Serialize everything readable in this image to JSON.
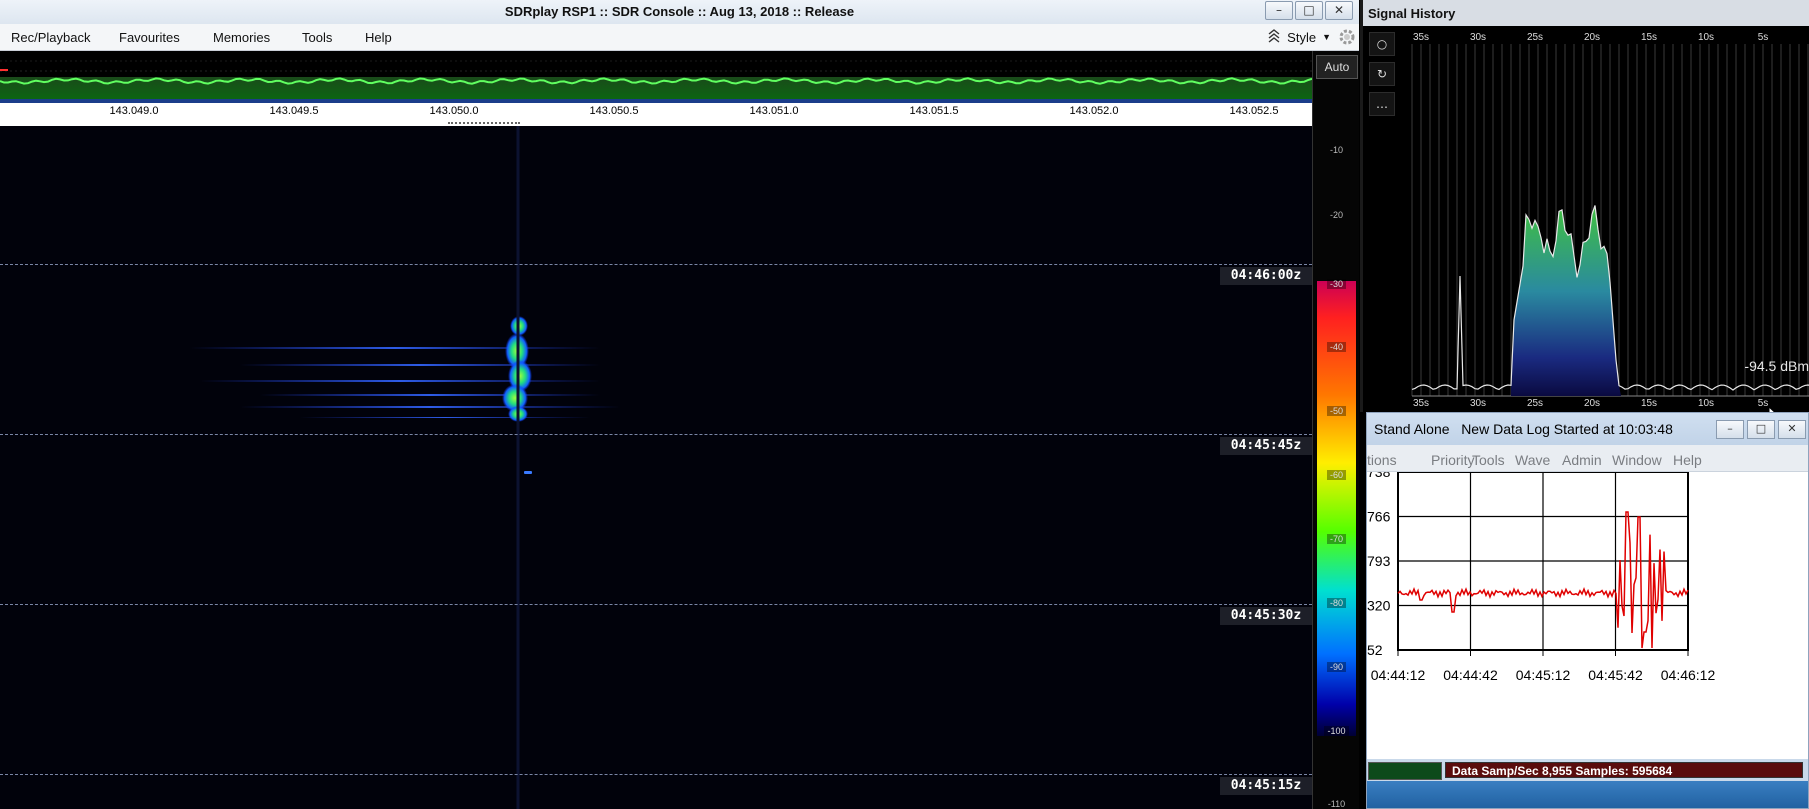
{
  "sdr": {
    "title": "SDRplay RSP1 :: SDR Console :: Aug 13, 2018 :: Release",
    "menu": [
      "Rec/Playback",
      "Favourites",
      "Memories",
      "Tools",
      "Help"
    ],
    "style_label": "Style",
    "freq_labels": [
      "143.049.0",
      "143.049.5",
      "143.050.0",
      "143.050.5",
      "143.051.0",
      "143.051.5",
      "143.052.0",
      "143.052.5"
    ],
    "time_labels": [
      "04:46:00z",
      "04:45:45z",
      "04:45:30z",
      "04:45:15z"
    ],
    "scale": {
      "auto_label": "Auto",
      "values": [
        "-10",
        "-20",
        "-30",
        "-40",
        "-50",
        "-60",
        "-70",
        "-80",
        "-90",
        "-100",
        "-110"
      ]
    },
    "colors": {
      "waterfall_bg": "#01020b",
      "spectrum_trace": "#30c030"
    }
  },
  "signal_history": {
    "title": "Signal History",
    "time_ticks": [
      "35s",
      "30s",
      "25s",
      "20s",
      "15s",
      "10s",
      "5s"
    ],
    "readout": "-94.5 dBm",
    "tools": [
      "record-icon",
      "refresh-icon",
      "more-icon"
    ]
  },
  "datalog": {
    "title_mode": "Stand Alone",
    "title_text": "New Data Log Started at 10:03:48",
    "menu": [
      "tions",
      "Priority",
      "Tools",
      "Wave",
      "Admin",
      "Window",
      "Help"
    ],
    "y_labels": [
      "738",
      "766",
      "793",
      "320",
      "52"
    ],
    "x_labels": [
      "04:44:12",
      "04:44:42",
      "04:45:12",
      "04:45:42",
      "04:46:12"
    ],
    "status": "Data Samp/Sec 8,955   Samples:  595684",
    "trace_color": "#e00000"
  }
}
